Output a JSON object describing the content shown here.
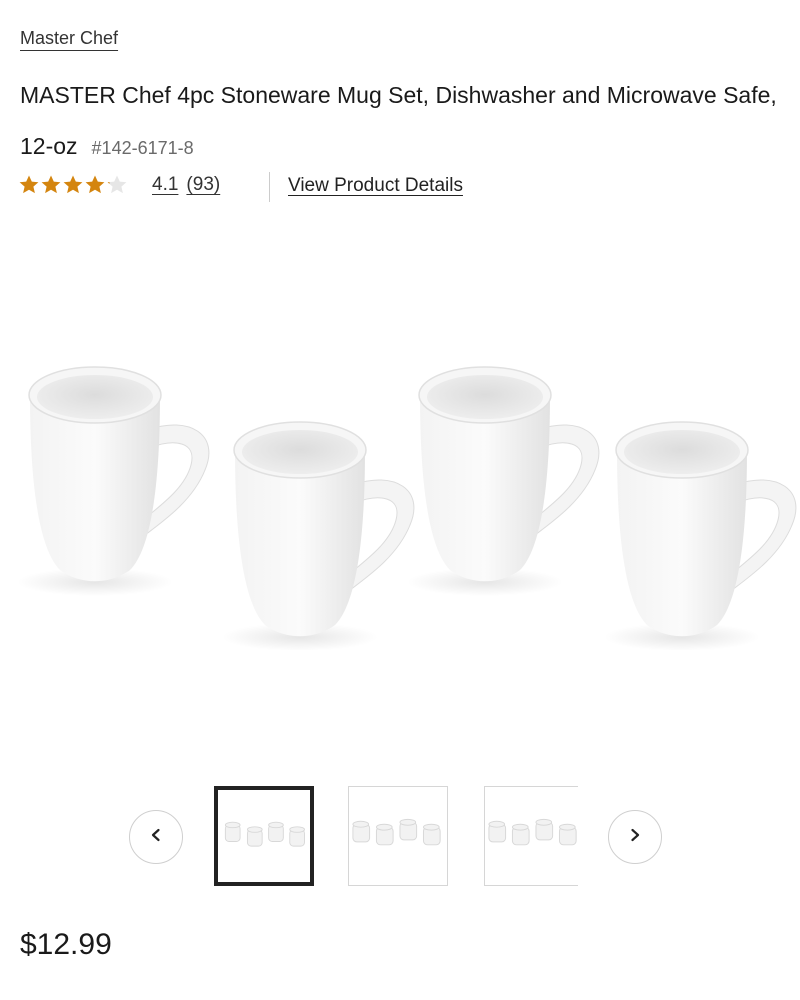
{
  "product": {
    "brand": "Master Chef",
    "title": "MASTER Chef 4pc Stoneware Mug Set, Dishwasher and Microwave Safe, 12-oz",
    "sku": "#142-6171-8",
    "rating": {
      "value": "4.1",
      "count": "(93)",
      "stars_filled": 4.1,
      "stars_total": 5,
      "star_color": "#D4850F",
      "star_empty_color": "#E6E6E6"
    },
    "view_details_label": "View Product Details",
    "price": "$12.99"
  },
  "gallery": {
    "main_image_icon": "mug-set-image",
    "thumbnails": [
      {
        "icon": "mug-set-thumbnail",
        "selected": true
      },
      {
        "icon": "mug-set-thumbnail",
        "selected": false
      },
      {
        "icon": "mug-set-thumbnail",
        "selected": false
      }
    ],
    "prev_icon": "chevron-left-icon",
    "next_icon": "chevron-right-icon"
  }
}
